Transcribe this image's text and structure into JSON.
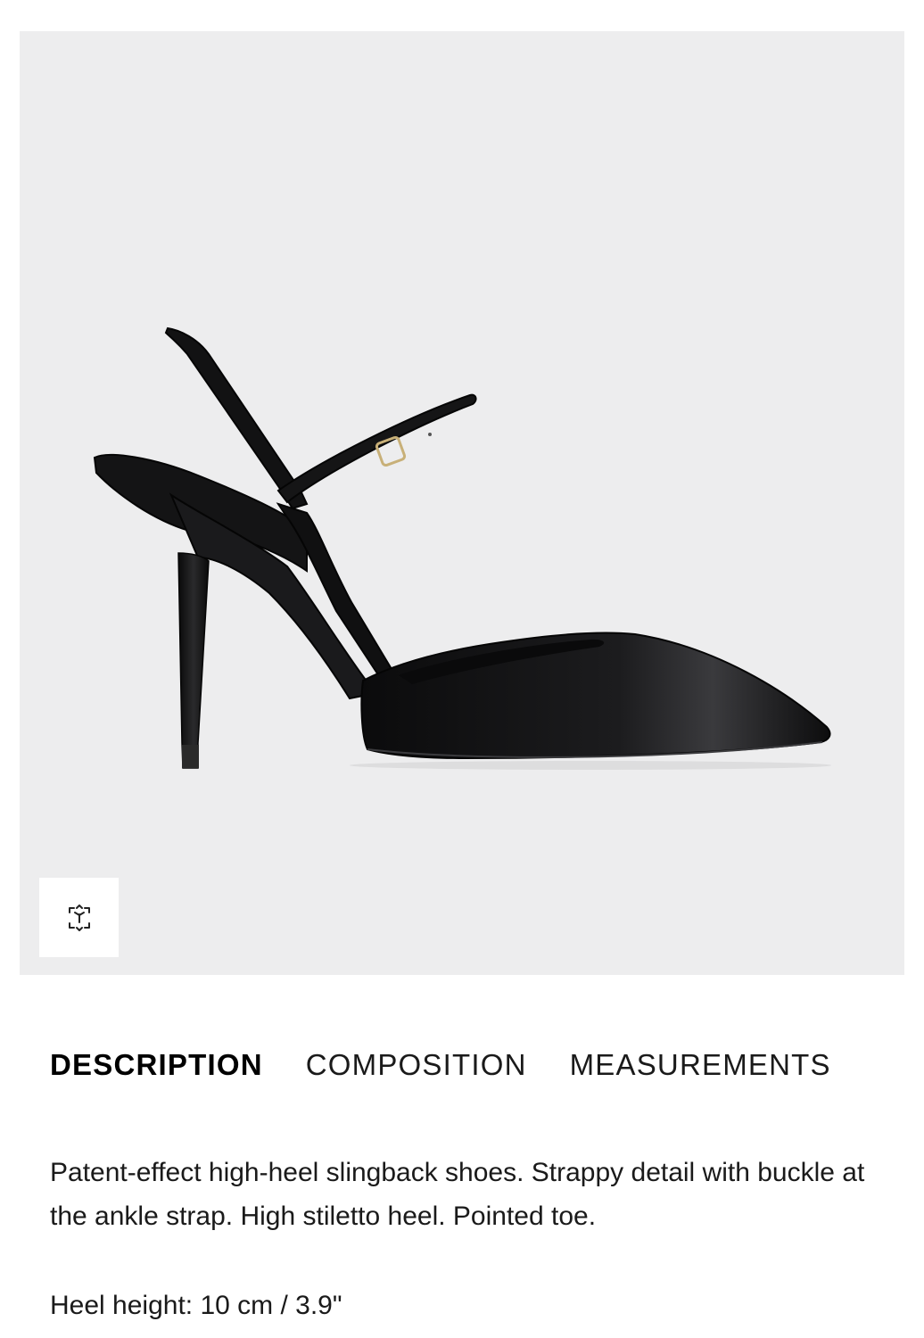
{
  "product_image": {
    "alt": "Patent-effect high-heel slingback shoes",
    "icon": "shoe-product-image",
    "background": "#ededee",
    "ar_button_icon": "ar-view-icon"
  },
  "tabs": [
    {
      "label": "DESCRIPTION",
      "active": true
    },
    {
      "label": "COMPOSITION",
      "active": false
    },
    {
      "label": "MEASUREMENTS",
      "active": false
    }
  ],
  "description": {
    "text": "Patent-effect high-heel slingback shoes. Strappy detail with buckle at the ankle strap. High stiletto heel. Pointed toe.",
    "heel_height": "Heel height: 10 cm / 3.9\""
  }
}
